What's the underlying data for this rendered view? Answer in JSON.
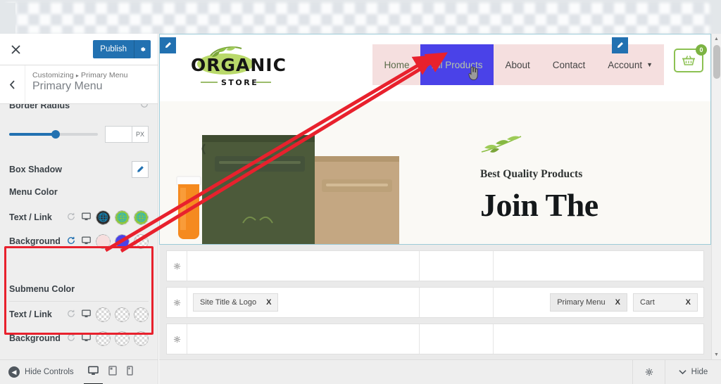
{
  "window": {
    "close_label": "×"
  },
  "customizer": {
    "publish_label": "Publish",
    "publish_gear_icon": "gear-icon",
    "back_icon": "chevron-left-icon",
    "breadcrumb_root": "Customizing",
    "breadcrumb_sep": "▸",
    "breadcrumb_current": "Primary Menu",
    "panel_title": "Primary Menu",
    "controls": {
      "border_radius": {
        "label": "Border Radius",
        "value": "",
        "unit": "PX",
        "slider_percent": 52,
        "reset_icon": "reset-icon"
      },
      "box_shadow": {
        "label": "Box Shadow",
        "edit_icon": "pencil-icon"
      },
      "menu_color": {
        "title": "Menu Color",
        "rows": [
          {
            "label": "Text / Link",
            "reset_active": false,
            "swatches": [
              "#2f2f2f",
              "#8dc63f",
              "#8dc63f"
            ],
            "swatch_kinds": [
              "solid",
              "solid",
              "solid"
            ]
          },
          {
            "label": "Background",
            "reset_active": true,
            "swatches": [
              "#f7dede",
              "#4a42e8",
              "transparent"
            ],
            "swatch_kinds": [
              "solid",
              "solid",
              "transparent"
            ]
          }
        ]
      },
      "submenu_color": {
        "title": "Submenu Color",
        "rows": [
          {
            "label": "Text / Link",
            "reset_active": false,
            "swatches": [
              "transparent",
              "transparent",
              "transparent"
            ],
            "swatch_kinds": [
              "transparent",
              "transparent",
              "transparent"
            ]
          },
          {
            "label": "Background",
            "reset_active": false,
            "swatches": [
              "transparent",
              "transparent",
              "transparent"
            ],
            "swatch_kinds": [
              "transparent",
              "transparent",
              "transparent"
            ]
          }
        ]
      }
    },
    "footer": {
      "hide_controls_label": "Hide Controls",
      "devices": [
        {
          "name": "desktop",
          "icon": "desktop-icon",
          "active": true
        },
        {
          "name": "tablet",
          "icon": "tablet-icon",
          "active": false
        },
        {
          "name": "mobile",
          "icon": "mobile-icon",
          "active": false
        }
      ]
    }
  },
  "preview": {
    "logo": {
      "line1": "ORGANIC",
      "line2": "STORE"
    },
    "nav_items": [
      {
        "label": "Home",
        "state": "normal"
      },
      {
        "label": "All Products",
        "state": "hover"
      },
      {
        "label": "About",
        "state": "plain"
      },
      {
        "label": "Contact",
        "state": "plain"
      },
      {
        "label": "Account",
        "state": "plain",
        "has_chevron": true
      }
    ],
    "cart": {
      "icon": "shopping-basket-icon",
      "badge_count": "0"
    },
    "hero": {
      "eyebrow": "Best Quality Products",
      "title": "Join The",
      "leaf_icon": "leaf-branch-icon"
    },
    "edit_icons": [
      "pencil-icon",
      "pencil-icon"
    ]
  },
  "widgets_panel": {
    "rows": [
      {
        "gear_icon": "gear-icon",
        "left_chips": [],
        "right_chips": []
      },
      {
        "gear_icon": "gear-icon",
        "left_chips": [
          {
            "label": "Site Title & Logo",
            "remove": "X"
          }
        ],
        "right_chips": [
          {
            "label": "Primary Menu",
            "remove": "X"
          },
          {
            "label": "Cart",
            "remove": "X"
          }
        ]
      },
      {
        "gear_icon": "gear-icon",
        "left_chips": [],
        "right_chips": []
      }
    ]
  },
  "bottom_bar": {
    "gear_icon": "gear-icon",
    "hide_label": "Hide",
    "hide_chevron": "chevron-down-icon"
  },
  "colors": {
    "wp_blue": "#2271b1",
    "annotation_red": "#e8212d",
    "nav_bg_pink": "#f5dfdf",
    "nav_hover_blue": "#4a42e8",
    "brand_green": "#8dc63f"
  }
}
